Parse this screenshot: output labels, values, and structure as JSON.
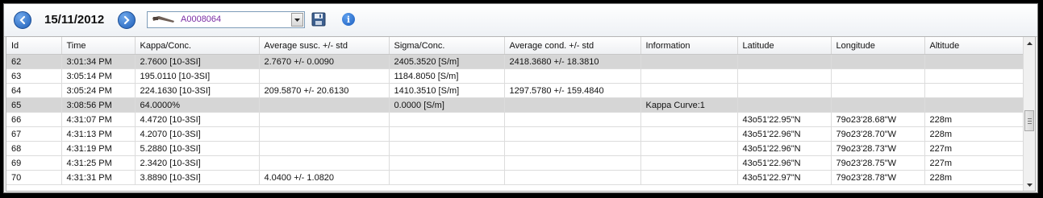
{
  "toolbar": {
    "date": "15/11/2012",
    "device": {
      "value": "A0008064"
    },
    "icons": {
      "prev": "arrow-left-circle-icon",
      "next": "arrow-right-circle-icon",
      "device": "tool-probe-icon",
      "save": "floppy-disk-icon",
      "info": "info-icon"
    }
  },
  "table": {
    "columns": [
      "Id",
      "Time",
      "Kappa/Conc.",
      "Average susc. +/- std",
      "Sigma/Conc.",
      "Average cond. +/- std",
      "Information",
      "Latitude",
      "Longitude",
      "Altitude"
    ],
    "rows": [
      {
        "highlight": true,
        "cells": [
          "62",
          "3:01:34 PM",
          "2.7600  [10-3SI]",
          "2.7670 +/- 0.0090",
          "2405.3520  [S/m]",
          "2418.3680 +/- 18.3810",
          "",
          "",
          "",
          ""
        ]
      },
      {
        "highlight": false,
        "cells": [
          "63",
          "3:05:14 PM",
          "195.0110  [10-3SI]",
          "",
          "1184.8050  [S/m]",
          "",
          "",
          "",
          "",
          ""
        ]
      },
      {
        "highlight": false,
        "cells": [
          "64",
          "3:05:24 PM",
          "224.1630  [10-3SI]",
          "209.5870 +/- 20.6130",
          "1410.3510  [S/m]",
          "1297.5780 +/- 159.4840",
          "",
          "",
          "",
          ""
        ]
      },
      {
        "highlight": true,
        "cells": [
          "65",
          "3:08:56 PM",
          "64.0000%",
          "",
          "0.0000  [S/m]",
          "",
          "Kappa Curve:1",
          "",
          "",
          ""
        ]
      },
      {
        "highlight": false,
        "cells": [
          "66",
          "4:31:07 PM",
          "4.4720  [10-3SI]",
          "",
          "",
          "",
          "",
          "43o51'22.95\"N",
          "79o23'28.68\"W",
          "228m"
        ]
      },
      {
        "highlight": false,
        "cells": [
          "67",
          "4:31:13 PM",
          "4.2070  [10-3SI]",
          "",
          "",
          "",
          "",
          "43o51'22.96\"N",
          "79o23'28.70\"W",
          "228m"
        ]
      },
      {
        "highlight": false,
        "cells": [
          "68",
          "4:31:19 PM",
          "5.2880  [10-3SI]",
          "",
          "",
          "",
          "",
          "43o51'22.96\"N",
          "79o23'28.73\"W",
          "227m"
        ]
      },
      {
        "highlight": false,
        "cells": [
          "69",
          "4:31:25 PM",
          "2.3420  [10-3SI]",
          "",
          "",
          "",
          "",
          "43o51'22.96\"N",
          "79o23'28.75\"W",
          "227m"
        ]
      },
      {
        "highlight": false,
        "cells": [
          "70",
          "4:31:31 PM",
          "3.8890  [10-3SI]",
          "4.0400 +/- 1.0820",
          "",
          "",
          "",
          "43o51'22.97\"N",
          "79o23'28.78\"W",
          "228m"
        ]
      }
    ]
  }
}
